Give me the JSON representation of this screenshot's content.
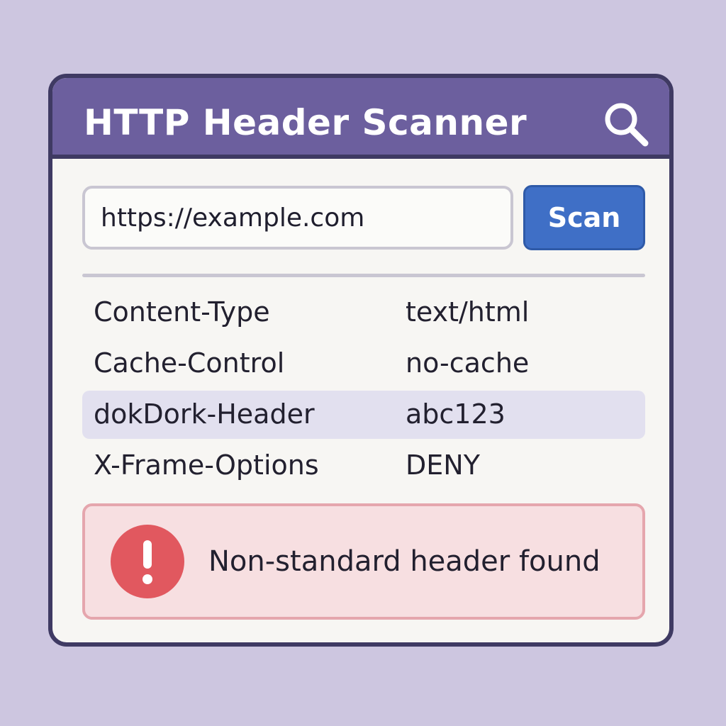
{
  "window": {
    "title": "HTTP Header Scanner"
  },
  "search": {
    "url_value": "https://example.com",
    "scan_label": "Scan"
  },
  "headers": [
    {
      "name": "Content-Type",
      "value": "text/html",
      "highlighted": false
    },
    {
      "name": "Cache-Control",
      "value": "no-cache",
      "highlighted": false
    },
    {
      "name": "dokDork-Header",
      "value": "abc123",
      "highlighted": true
    },
    {
      "name": "X-Frame-Options",
      "value": "DENY",
      "highlighted": false
    }
  ],
  "alert": {
    "message": "Non-standard header found",
    "icon": "exclamation-icon"
  },
  "colors": {
    "background": "#cdc6e0",
    "titlebar": "#6c5f9e",
    "accent_button": "#3f6fc6",
    "highlight_row": "#e2e0ef",
    "alert_bg": "#f7dfe1",
    "alert_icon": "#e1585f"
  },
  "icons": {
    "titlebar_icon": "search-icon"
  }
}
